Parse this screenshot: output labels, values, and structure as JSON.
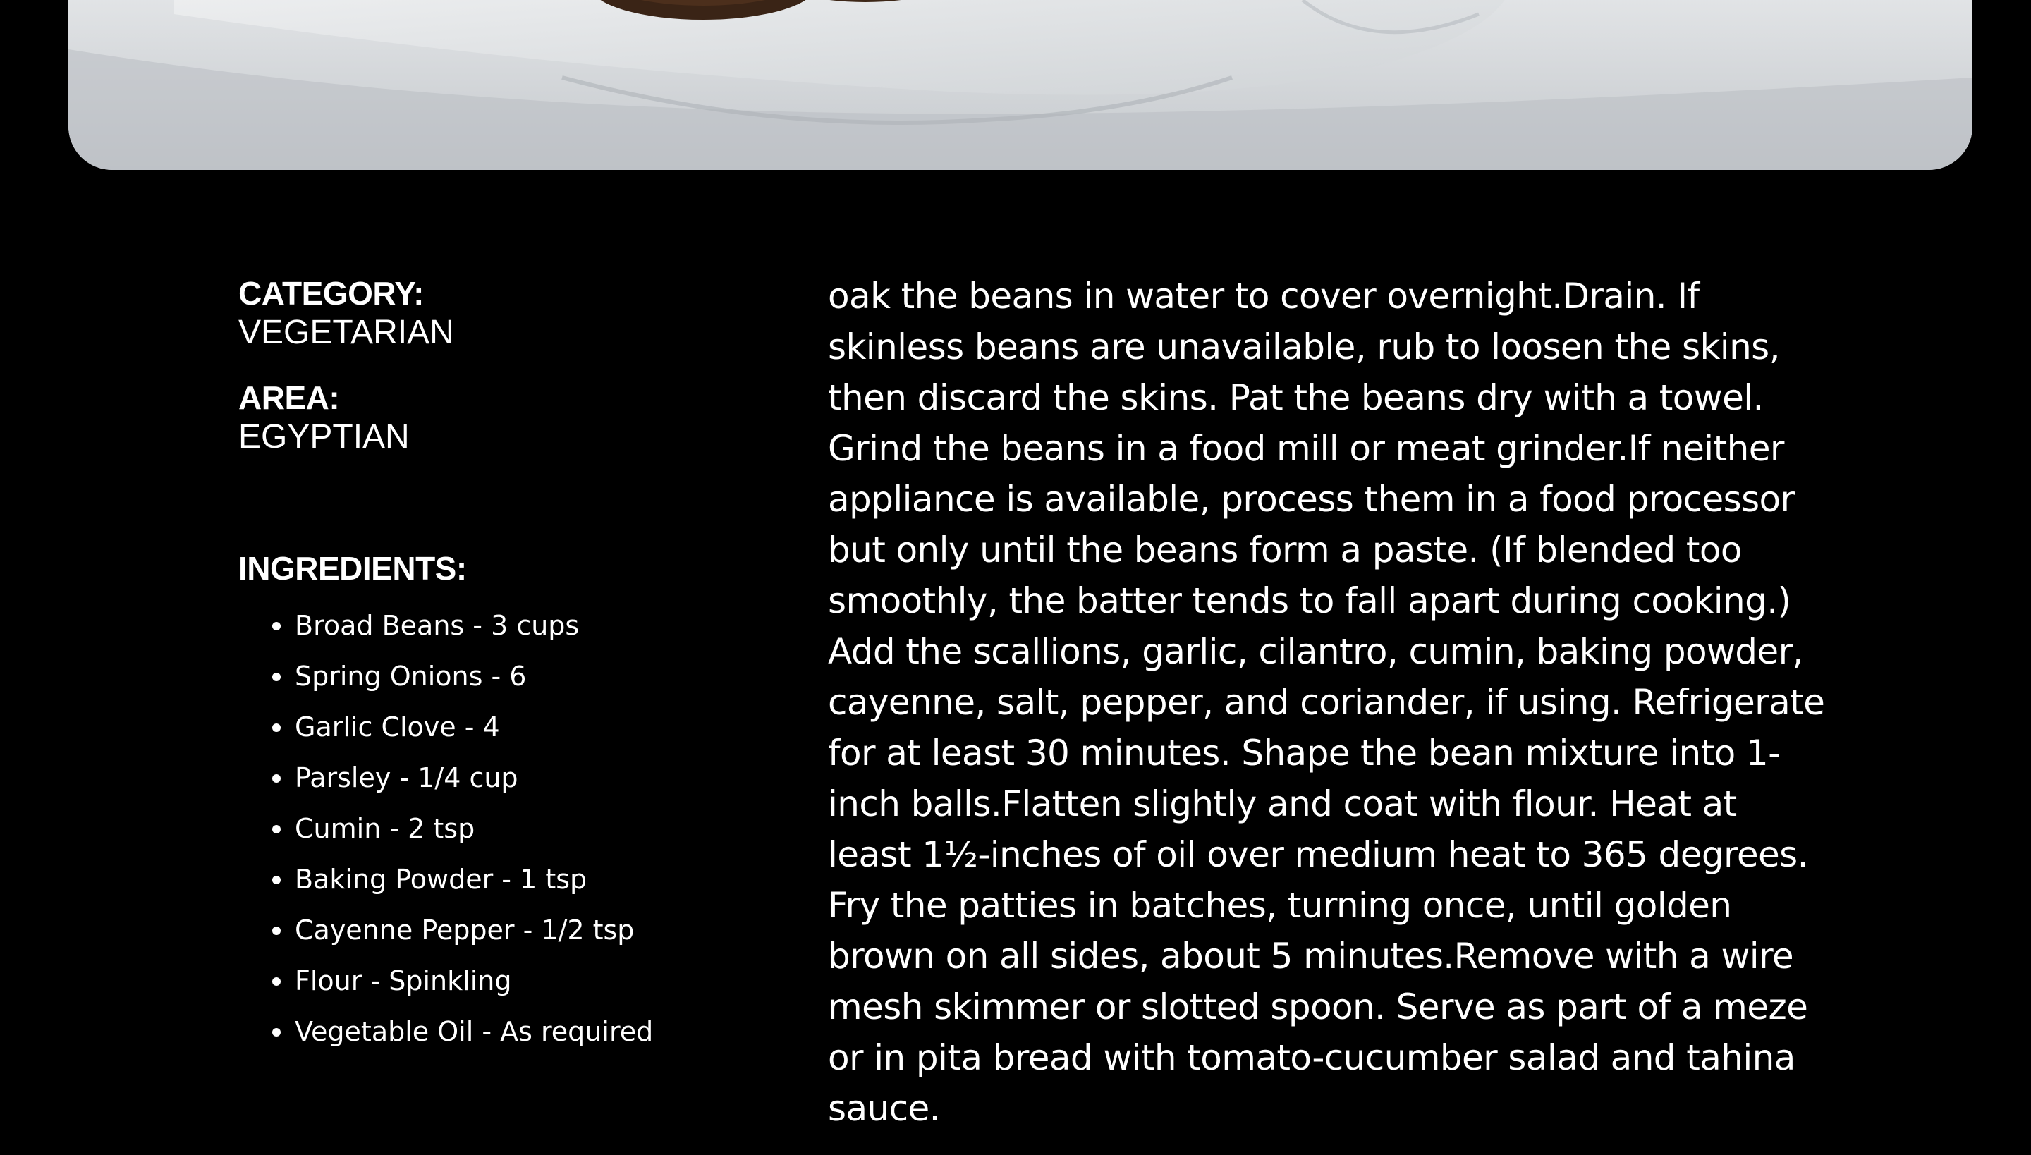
{
  "meal": {
    "category_label": "CATEGORY:",
    "category": "VEGETARIAN",
    "area_label": "AREA:",
    "area": "EGYPTIAN",
    "ingredients_label": "INGREDIENTS:",
    "ingredients": [
      "Broad Beans - 3 cups",
      "Spring Onions - 6",
      "Garlic Clove - 4",
      "Parsley - 1/4 cup",
      "Cumin - 2 tsp",
      "Baking Powder - 1 tsp",
      "Cayenne Pepper - 1/2 tsp",
      "Flour - Spinkling",
      "Vegetable Oil - As required"
    ],
    "instructions": "oak the beans in water to cover overnight.Drain. If skinless beans are unavailable, rub to loosen the skins, then discard the skins. Pat the beans dry with a towel. Grind the beans in a food mill or meat grinder.If neither appliance is available, process them in a food processor but only until the beans form a paste. (If blended too smoothly, the batter tends to fall apart during cooking.) Add the scallions, garlic, cilantro, cumin, baking powder, cayenne, salt, pepper, and coriander, if using. Refrigerate for at least 30 minutes. Shape the bean mixture into 1-inch balls.Flatten slightly and coat with flour. Heat at least 1½-inches of oil over medium heat to 365 degrees. Fry the patties in batches, turning once, until golden brown on all sides, about 5 minutes.Remove with a wire mesh skimmer or slotted spoon. Serve as part of a meze or in pita bread with tomato-cucumber salad and tahina sauce."
  },
  "theme": {
    "background": "#000000",
    "text": "#ffffff"
  }
}
